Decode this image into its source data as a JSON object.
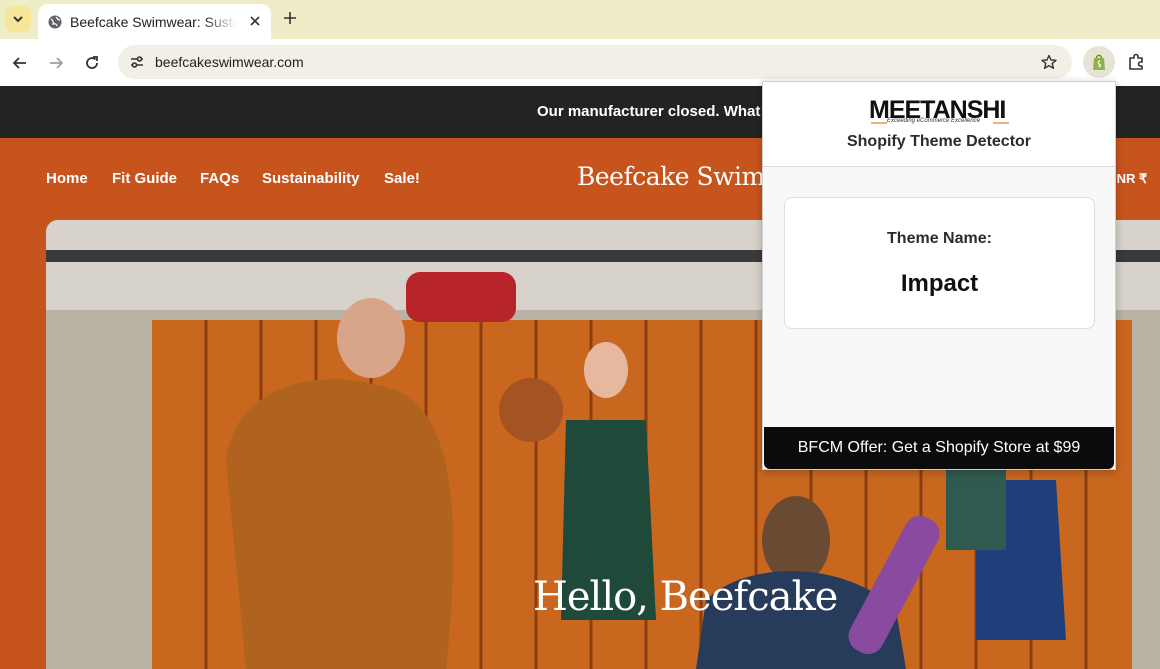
{
  "browser": {
    "tab": {
      "title": "Beefcake Swimwear: Sustainable Swimwear for Every Body"
    },
    "url": "beefcakeswimwear.com"
  },
  "colors": {
    "tabbar": "#efedc8",
    "announcement_bar": "#232323",
    "header": "#c8541d",
    "popup_offer_bar": "#0b0b0b"
  },
  "site": {
    "announcement": "Our manufacturer closed. What",
    "nav": [
      "Home",
      "Fit Guide",
      "FAQs",
      "Sustainability",
      "Sale!"
    ],
    "brand": "Beefcake Swimwear",
    "currency": "INR ₹",
    "hero_heading": "Hello, Beefcake"
  },
  "extension": {
    "logo_text": "MEETANSHI",
    "logo_tagline": "Exceeding eCommerce Excellence",
    "title": "Shopify Theme Detector",
    "theme_label": "Theme Name:",
    "theme_value": "Impact",
    "offer": "BFCM Offer: Get a Shopify Store at $99"
  },
  "icons": [
    "tab-list-icon",
    "globe-icon",
    "close-icon",
    "plus-icon",
    "back-arrow-icon",
    "forward-arrow-icon",
    "reload-icon",
    "site-info-icon",
    "star-icon",
    "shopify-bag-icon",
    "puzzle-icon"
  ]
}
